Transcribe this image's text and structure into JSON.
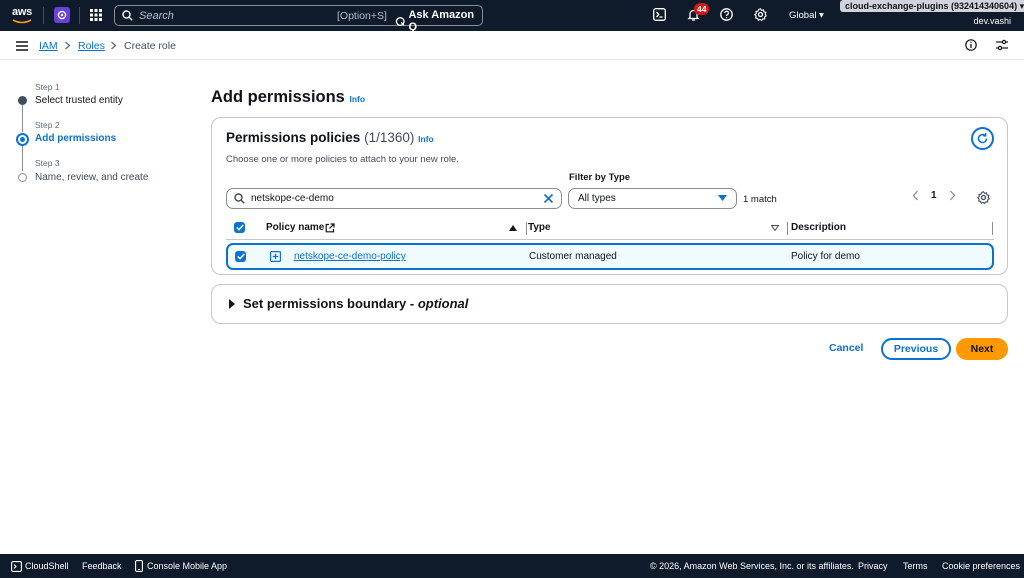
{
  "topnav": {
    "logo_text": "aws",
    "search_placeholder": "Search",
    "search_shortcut": "[Option+S]",
    "ask_q_label": "Ask Amazon Q",
    "notifications_count": "44",
    "region_label": "Global",
    "account_label": "cloud-exchange-plugins (932414340604)",
    "user_label": "dev.vashi"
  },
  "breadcrumb": {
    "items": [
      "IAM",
      "Roles",
      "Create role"
    ]
  },
  "steps": [
    {
      "small": "Step 1",
      "label": "Select trusted entity"
    },
    {
      "small": "Step 2",
      "label": "Add permissions"
    },
    {
      "small": "Step 3",
      "label": "Name, review, and create"
    }
  ],
  "page": {
    "title": "Add permissions",
    "info": "Info"
  },
  "policies": {
    "title": "Permissions policies",
    "count": "(1/1360)",
    "info": "Info",
    "description": "Choose one or more policies to attach to your new role.",
    "filter_label": "Filter by Type",
    "search_value": "netskope-ce-demo",
    "type_value": "All types",
    "match_text": "1 match",
    "page_number": "1",
    "columns": [
      "Policy name",
      "Type",
      "Description"
    ],
    "rows": [
      {
        "name": "netskope-ce-demo-policy",
        "type": "Customer managed",
        "description": "Policy for demo"
      }
    ]
  },
  "boundary": {
    "title": "Set permissions boundary - ",
    "optional": "optional"
  },
  "actions": {
    "cancel": "Cancel",
    "previous": "Previous",
    "next": "Next"
  },
  "footer": {
    "cloudshell": "CloudShell",
    "feedback": "Feedback",
    "mobile_app": "Console Mobile App",
    "copyright": "© 2026, Amazon Web Services, Inc. or its affiliates.",
    "privacy": "Privacy",
    "terms": "Terms",
    "cookies": "Cookie preferences"
  },
  "colors": {
    "nav_bg": "#0f1b2a",
    "link": "#0972d3",
    "primary_button": "#ff9900",
    "badge": "#d91515"
  }
}
